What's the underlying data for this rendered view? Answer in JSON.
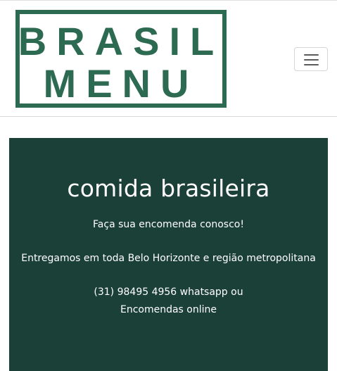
{
  "brand": {
    "logo_line1": "BRASIL",
    "logo_line2": "MENU",
    "logo_color": "#2d6a52"
  },
  "navbar": {
    "toggler_icon": "hamburger-menu-icon"
  },
  "hero": {
    "background_color": "#1b4038",
    "title": "comida brasileira",
    "subtitle": "Faça sua encomenda conosco!",
    "delivery_text": "Entregamos em toda Belo Horizonte e região metropolitana",
    "phone_text": "(31) 98495 4956 whatsapp ou",
    "online_link": "Encomendas online"
  }
}
